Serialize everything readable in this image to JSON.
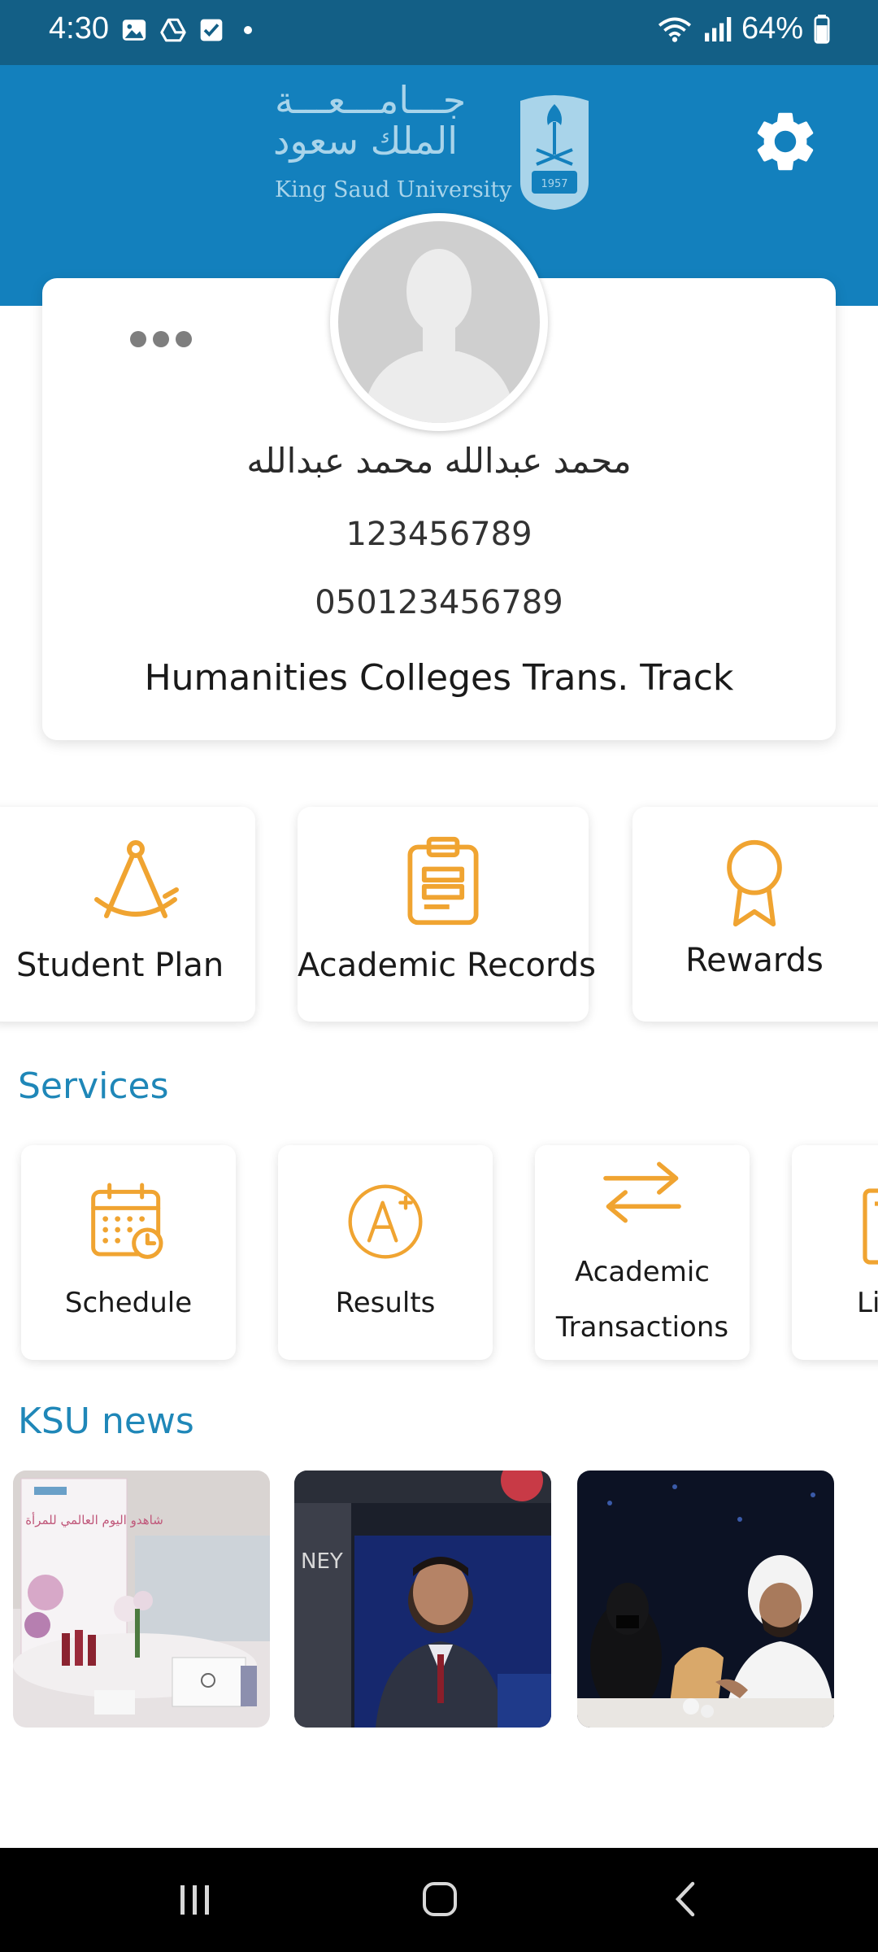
{
  "status_bar": {
    "time": "4:30",
    "battery": "64%",
    "left_icons": [
      "gallery-icon",
      "drive-icon",
      "tasks-icon",
      "dot-icon"
    ],
    "right_icons": [
      "wifi-icon",
      "signal-icon",
      "battery-icon"
    ]
  },
  "header": {
    "logo_ar_line1": "جـــامـــعـــة",
    "logo_ar_line2": "الملك سعود",
    "logo_en": "King Saud University",
    "emblem_year": "1957"
  },
  "profile": {
    "name": "محمد عبدالله محمد عبدالله",
    "student_id": "123456789",
    "phone": "050123456789",
    "track": "Humanities Colleges Trans. Track"
  },
  "quick_access": [
    {
      "label": "Student Plan",
      "icon": "compass-icon"
    },
    {
      "label": "Academic Records",
      "icon": "clipboard-icon"
    },
    {
      "label": "Rewards",
      "icon": "award-icon"
    }
  ],
  "services": {
    "title": "Services",
    "items": [
      {
        "label": "Schedule",
        "icon": "calendar-clock-icon"
      },
      {
        "label": "Results",
        "icon": "grade-a-plus-icon"
      },
      {
        "label_line1": "Academic",
        "label_line2": "Transactions",
        "icon": "transfer-arrows-icon"
      },
      {
        "label": "Li",
        "icon": "library-icon"
      }
    ]
  },
  "news": {
    "title": "KSU news",
    "items": [
      {
        "image_ar_text": "شاهدو اليوم العالمي للمرأة"
      },
      {
        "image_text": "NEY"
      },
      {}
    ]
  },
  "colors": {
    "status_bar": "#135f86",
    "header": "#1380bd",
    "accent_orange": "#f0a431",
    "section_title": "#1f87b8"
  }
}
